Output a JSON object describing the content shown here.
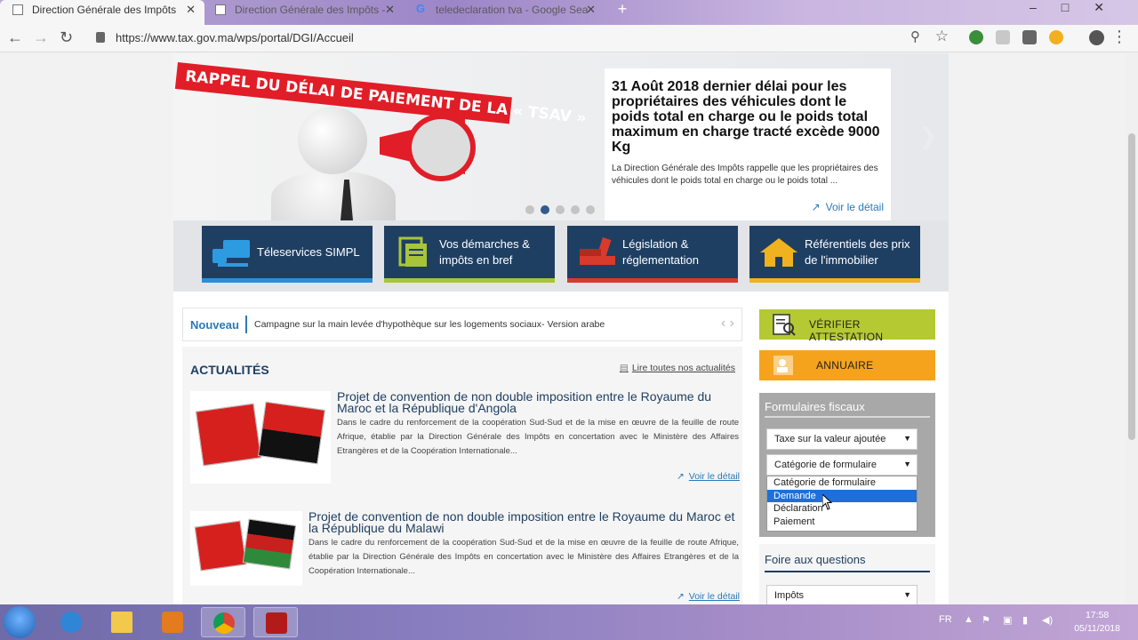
{
  "browser": {
    "tabs": [
      {
        "label": "Direction Générale des Impôts",
        "active": true
      },
      {
        "label": "Direction Générale des Impôts -",
        "active": false
      },
      {
        "label": "teledeclaration tva - Google Sea",
        "active": false
      }
    ],
    "url": "https://www.tax.gov.ma/wps/portal/DGI/Accueil"
  },
  "slider": {
    "banner": "RAPPEL DU DÉLAI DE PAIEMENT DE LA « TSAV »",
    "title": "31 Août 2018 dernier délai pour les propriétaires des véhicules dont le poids total en charge ou le poids total maximum en charge tracté excède 9000 Kg",
    "description": "La Direction Générale des Impôts rappelle que les propriétaires des véhicules dont le poids total en charge ou le poids total ...",
    "link": "Voir le détail",
    "active_dot": 2,
    "dot_count": 5
  },
  "tiles": [
    {
      "label": "Téleservices SIMPL"
    },
    {
      "label": "Vos démarches & impôts en bref"
    },
    {
      "label": "Législation & réglementation"
    },
    {
      "label": "Référentiels des prix de l'immobilier"
    }
  ],
  "news": {
    "tag": "Nouveau",
    "text": "Campagne sur la main levée d'hypothèque sur les logements sociaux- Version arabe"
  },
  "actualites": {
    "title": "ACTUALITÉS",
    "all_link": "Lire toutes nos actualités",
    "articles": [
      {
        "title": "Projet de convention de non double imposition entre le Royaume du Maroc et la République d'Angola",
        "body": "Dans le cadre du renforcement de la coopération Sud-Sud et de la mise en œuvre de la feuille de route Afrique, établie par la Direction Générale des Impôts en concertation avec le Ministère des Affaires Etrangères et de la Coopération Internationale...",
        "link": "Voir le détail"
      },
      {
        "title": "Projet de convention de non double imposition entre le Royaume du Maroc et la République du Malawi",
        "body": "Dans le cadre du renforcement de la coopération Sud-Sud et de la mise en œuvre de la feuille de route Afrique, établie par la Direction Générale des Impôts en concertation avec le Ministère des Affaires Etrangères et de la Coopération Internationale...",
        "link": "Voir le détail"
      }
    ]
  },
  "sidebar": {
    "verify": "VÉRIFIER ATTESTATION",
    "annuaire": "ANNUAIRE",
    "forms": {
      "title": "Formulaires fiscaux",
      "tax_select": "Taxe sur la valeur ajoutée",
      "category_select": "Catégorie de formulaire",
      "options": [
        "Catégorie de formulaire",
        "Demande",
        "Déclaration",
        "Paiement"
      ],
      "highlighted_option": "Demande"
    },
    "faq": {
      "title": "Foire aux questions",
      "select": "Impôts"
    }
  },
  "taskbar": {
    "language": "FR",
    "time": "17:58",
    "date": "05/11/2018"
  },
  "colors": {
    "brand_navy": "#1f3f62",
    "link_blue": "#2a7ab8",
    "verify_green": "#b5c933",
    "annuaire_orange": "#f5a31c",
    "banner_red": "#e11d27"
  }
}
